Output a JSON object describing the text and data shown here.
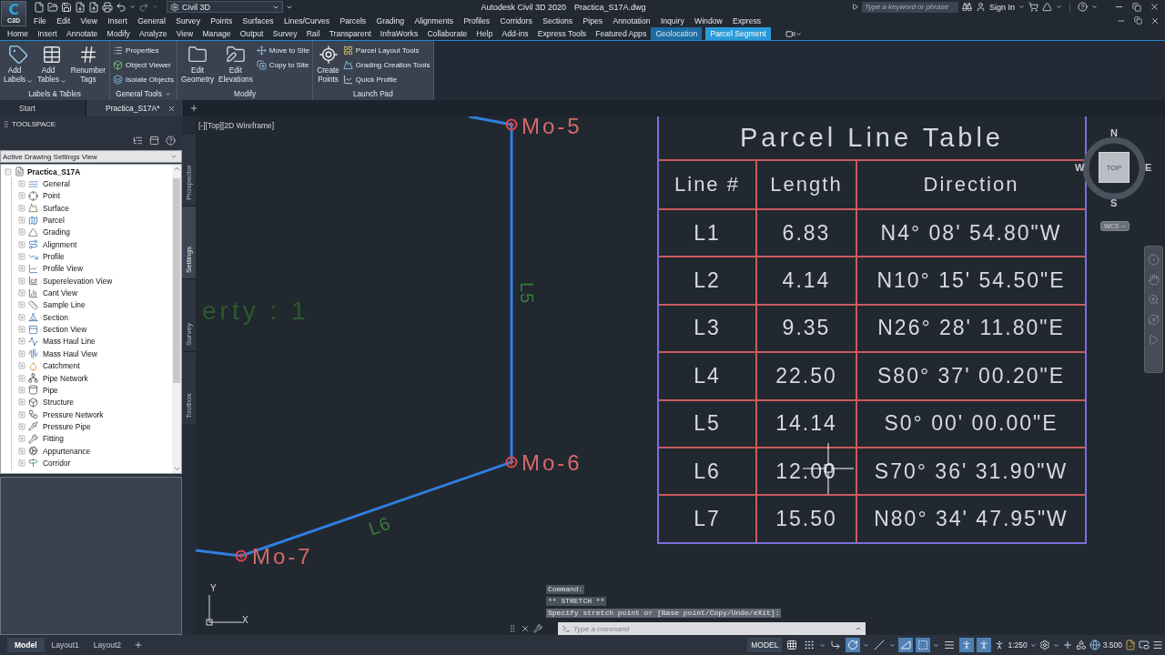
{
  "title_bar": {
    "app_button": {
      "logo": "C",
      "label": "C3D"
    },
    "workspace": "Civil 3D",
    "title": "Autodesk Civil 3D 2020",
    "document": "Practica_S17A.dwg",
    "search": {
      "placeholder": "Type a keyword or phrase"
    },
    "sign_in": "Sign In"
  },
  "menu_bar": [
    "File",
    "Edit",
    "View",
    "Insert",
    "General",
    "Survey",
    "Points",
    "Surfaces",
    "Lines/Curves",
    "Parcels",
    "Grading",
    "Alignments",
    "Profiles",
    "Corridors",
    "Sections",
    "Pipes",
    "Annotation",
    "Inquiry",
    "Window",
    "Express"
  ],
  "ribbon_tabs": [
    {
      "label": "Home",
      "selected": false,
      "contextual": false
    },
    {
      "label": "Insert",
      "selected": false,
      "contextual": false
    },
    {
      "label": "Annotate",
      "selected": false,
      "contextual": false
    },
    {
      "label": "Modify",
      "selected": false,
      "contextual": false
    },
    {
      "label": "Analyze",
      "selected": false,
      "contextual": false
    },
    {
      "label": "View",
      "selected": false,
      "contextual": false
    },
    {
      "label": "Manage",
      "selected": false,
      "contextual": false
    },
    {
      "label": "Output",
      "selected": false,
      "contextual": false
    },
    {
      "label": "Survey",
      "selected": false,
      "contextual": false
    },
    {
      "label": "Rail",
      "selected": false,
      "contextual": false
    },
    {
      "label": "Transparent",
      "selected": false,
      "contextual": false
    },
    {
      "label": "InfraWorks",
      "selected": false,
      "contextual": false
    },
    {
      "label": "Collaborate",
      "selected": false,
      "contextual": false
    },
    {
      "label": "Help",
      "selected": false,
      "contextual": false
    },
    {
      "label": "Add-ins",
      "selected": false,
      "contextual": false
    },
    {
      "label": "Express Tools",
      "selected": false,
      "contextual": false
    },
    {
      "label": "Featured Apps",
      "selected": false,
      "contextual": false
    },
    {
      "label": "Geolocation",
      "selected": false,
      "contextual": true
    },
    {
      "label": "Parcel Segment",
      "selected": true,
      "contextual": true
    }
  ],
  "ribbon_panels": [
    {
      "title": "Labels & Tables",
      "menu": false,
      "tools": [
        {
          "kind": "large",
          "label": "Add Labels",
          "dropdown": true
        },
        {
          "kind": "large",
          "label": "Add Tables",
          "dropdown": true
        },
        {
          "kind": "large",
          "label": "Renumber Tags",
          "dropdown": false
        }
      ]
    },
    {
      "title": "General Tools",
      "menu": true,
      "tools": [
        {
          "kind": "small",
          "label": "Properties"
        },
        {
          "kind": "small",
          "label": "Object Viewer"
        },
        {
          "kind": "small",
          "label": "Isolate Objects"
        }
      ]
    },
    {
      "title": "Modify",
      "menu": false,
      "tools": [
        {
          "kind": "large",
          "label": "Edit Geometry",
          "dropdown": false
        },
        {
          "kind": "large",
          "label": "Edit Elevations",
          "dropdown": false
        },
        {
          "kind": "small",
          "label": "Move to Site"
        },
        {
          "kind": "small",
          "label": "Copy to Site"
        }
      ]
    },
    {
      "title": "Launch Pad",
      "menu": false,
      "tools": [
        {
          "kind": "large",
          "label": "Create Points",
          "dropdown": false
        },
        {
          "kind": "small",
          "label": "Parcel Layout Tools"
        },
        {
          "kind": "small",
          "label": "Grading Creation Tools"
        },
        {
          "kind": "small",
          "label": "Quick Profile"
        }
      ]
    }
  ],
  "file_tabs": [
    {
      "label": "Start",
      "selected": false
    },
    {
      "label": "Practica_S17A*",
      "selected": true
    }
  ],
  "toolspace": {
    "title": "TOOLSPACE",
    "view": "Active Drawing Settings View",
    "tree": {
      "label": "Practica_S17A",
      "expanded": true,
      "children": [
        {
          "label": "General",
          "expanded": false
        },
        {
          "label": "Point",
          "expanded": false
        },
        {
          "label": "Surface",
          "expanded": false
        },
        {
          "label": "Parcel",
          "expanded": false
        },
        {
          "label": "Grading",
          "expanded": false
        },
        {
          "label": "Alignment",
          "expanded": false
        },
        {
          "label": "Profile",
          "expanded": false
        },
        {
          "label": "Profile View",
          "expanded": false
        },
        {
          "label": "Superelevation View",
          "expanded": false
        },
        {
          "label": "Cant View",
          "expanded": false
        },
        {
          "label": "Sample Line",
          "expanded": false
        },
        {
          "label": "Section",
          "expanded": false
        },
        {
          "label": "Section View",
          "expanded": false
        },
        {
          "label": "Mass Haul Line",
          "expanded": false
        },
        {
          "label": "Mass Haul View",
          "expanded": false
        },
        {
          "label": "Catchment",
          "expanded": false
        },
        {
          "label": "Pipe Network",
          "expanded": false
        },
        {
          "label": "Pipe",
          "expanded": false
        },
        {
          "label": "Structure",
          "expanded": false
        },
        {
          "label": "Pressure Network",
          "expanded": false
        },
        {
          "label": "Pressure Pipe",
          "expanded": false
        },
        {
          "label": "Fitting",
          "expanded": false
        },
        {
          "label": "Appurtenance",
          "expanded": false
        },
        {
          "label": "Corridor",
          "expanded": false
        }
      ]
    },
    "tabs": [
      {
        "label": "Prospector",
        "selected": false
      },
      {
        "label": "Settings",
        "selected": true
      },
      {
        "label": "Survey",
        "selected": false
      },
      {
        "label": "Toolbox",
        "selected": false
      }
    ]
  },
  "drawing": {
    "viewport_label": "[-][Top][2D Wireframe]",
    "partial_text": "erty : 1",
    "points": [
      {
        "label": "Mo-5"
      },
      {
        "label": "Mo-6"
      },
      {
        "label": "Mo-7"
      }
    ],
    "segments": [
      {
        "label": "L5"
      },
      {
        "label": "L6"
      }
    ],
    "table": {
      "title": "Parcel Line Table",
      "columns": [
        "Line #",
        "Length",
        "Direction"
      ],
      "rows": [
        [
          "L1",
          "6.83",
          "N4° 08' 54.80\"W"
        ],
        [
          "L2",
          "4.14",
          "N10° 15' 54.50\"E"
        ],
        [
          "L3",
          "9.35",
          "N26° 28' 11.80\"E"
        ],
        [
          "L4",
          "22.50",
          "S80° 37' 00.20\"E"
        ],
        [
          "L5",
          "14.14",
          "S0° 00' 00.00\"E"
        ],
        [
          "L6",
          "12.00",
          "S70° 36' 31.90\"W"
        ],
        [
          "L7",
          "15.50",
          "N80° 34' 47.95\"W"
        ]
      ]
    },
    "viewcube": {
      "face": "TOP",
      "north": "N",
      "south": "S",
      "east": "E",
      "west": "W",
      "ucs": "WCS"
    },
    "ucs_axes": {
      "x": "X",
      "y": "Y"
    }
  },
  "command_line": {
    "history": [
      "Command:",
      "** STRETCH **",
      "Specify stretch point or [Base point/Copy/Undo/eXit]:"
    ],
    "input": {
      "placeholder": "Type a command"
    }
  },
  "layout_tabs": [
    {
      "label": "Model",
      "selected": true
    },
    {
      "label": "Layout1",
      "selected": false
    },
    {
      "label": "Layout2",
      "selected": false
    }
  ],
  "status_bar": {
    "space": "MODEL",
    "toggles": [
      {
        "on": false
      },
      {
        "on": false
      },
      {
        "on": false
      },
      {
        "on": true
      },
      {
        "on": false
      },
      {
        "on": true
      },
      {
        "on": true
      },
      {
        "on": false
      },
      {
        "on": true
      },
      {
        "on": true
      }
    ],
    "scale": "1:250",
    "value": "3.500"
  }
}
